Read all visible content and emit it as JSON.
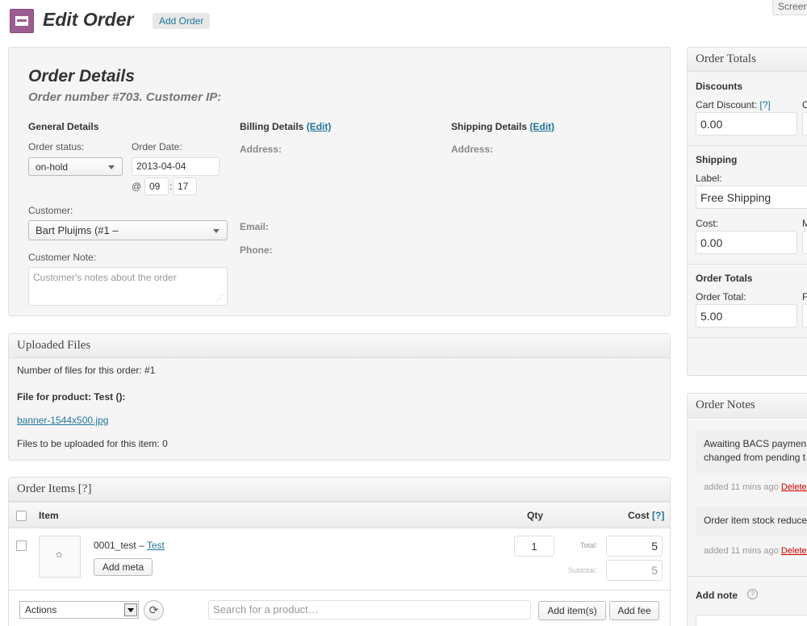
{
  "header": {
    "title": "Edit Order",
    "add_order": "Add Order",
    "screen_options": "Screen"
  },
  "order_details": {
    "heading": "Order Details",
    "subheading": "Order number #703. Customer IP:",
    "general_details": "General Details",
    "order_status_label": "Order status:",
    "order_status_value": "on-hold",
    "order_date_label": "Order Date:",
    "order_date_value": "2013-04-04",
    "at": "@",
    "hour": "09",
    "colon": ":",
    "minute": "17",
    "customer_label": "Customer:",
    "customer_value": "Bart Pluijms (#1 – ",
    "customer_note_label": "Customer Note:",
    "customer_note_placeholder": "Customer's notes about the order",
    "billing_title": "Billing Details",
    "billing_edit": "(Edit)",
    "billing_address_label": "Address:",
    "email_label": "Email:",
    "phone_label": "Phone:",
    "shipping_title": "Shipping Details",
    "shipping_edit": "(Edit)",
    "shipping_address_label": "Address:"
  },
  "uploaded_files": {
    "heading": "Uploaded Files",
    "count_text": "Number of files for this order: #1",
    "file_for_product": "File for product: Test ():",
    "file_link": "banner-1544x500.jpg",
    "to_upload": "Files to be uploaded for this item: 0"
  },
  "order_items": {
    "heading": "Order Items [?]",
    "col_item": "Item",
    "col_qty": "Qty",
    "col_cost": "Cost",
    "col_cost_help": "[?]",
    "row": {
      "sku": "0001_test –",
      "product_link": "Test",
      "add_meta": "Add meta",
      "qty": "1",
      "total_label": "Total:",
      "total_value": "5",
      "subtotal_label": "Subtotal:",
      "subtotal_value": "5"
    },
    "actions_select": "Actions",
    "search_placeholder": "Search for a product…",
    "add_items": "Add item(s)",
    "add_fee": "Add fee"
  },
  "order_totals": {
    "heading": "Order Totals",
    "discounts": "Discounts",
    "cart_discount_label": "Cart Discount:",
    "cart_discount_help": "[?]",
    "cart_discount_value": "0.00",
    "order_discount_label": "O",
    "shipping": "Shipping",
    "shipping_label_label": "Label:",
    "shipping_label_value": "Free Shipping",
    "cost_label": "Cost:",
    "cost_value": "0.00",
    "method_label": "M",
    "order_totals_title": "Order Totals",
    "order_total_label": "Order Total:",
    "order_total_value": "5.00",
    "payment_label": "F"
  },
  "order_notes": {
    "heading": "Order Notes",
    "notes": [
      {
        "line1": "Awaiting BACS paymen",
        "line2": "changed from pending t",
        "meta": "added 11 mins ago",
        "delete": "Delete n"
      },
      {
        "line1": "Order item stock reduce",
        "meta": "added 11 mins ago",
        "delete": "Delete n"
      }
    ],
    "add_note": "Add note",
    "help": "?"
  }
}
